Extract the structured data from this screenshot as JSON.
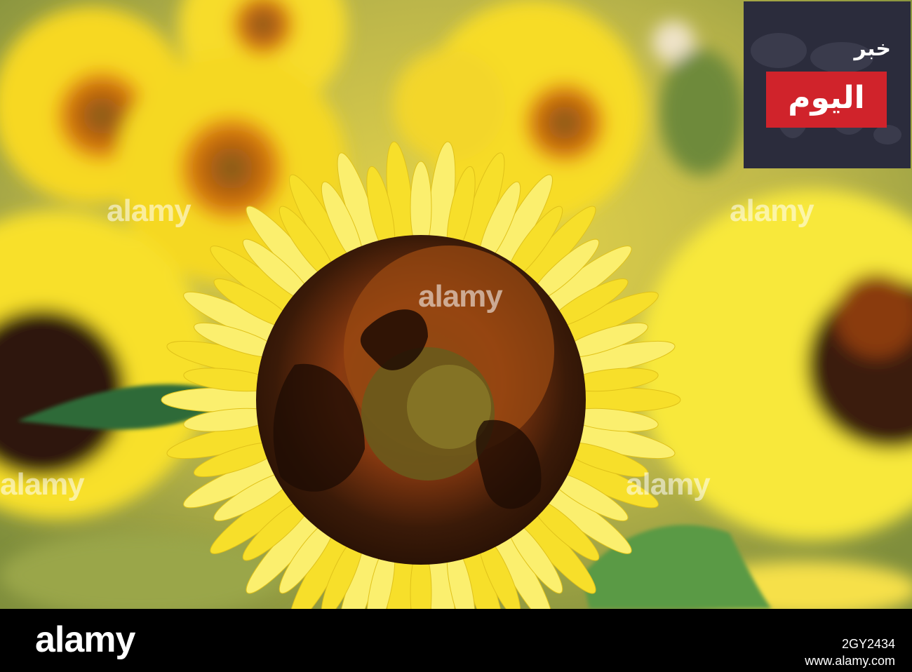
{
  "photo": {
    "subject": "sunflower",
    "colors": {
      "petal": "#f7df2a",
      "petal_light": "#fbef6e",
      "center_dark": "#3a1a08",
      "center_rust": "#8a3a10",
      "leaf": "#3f7f3a",
      "background_blur": "#c9c04a"
    }
  },
  "watermarks": {
    "text": "alamy"
  },
  "logo": {
    "top_text": "خبر",
    "red_text": "اليوم",
    "box_color": "#2b2c3c",
    "red_color": "#d0232b",
    "icon": "world-map-icon"
  },
  "footer": {
    "brand": "alamy",
    "image_id": "2GY2434",
    "site": "www.alamy.com"
  }
}
